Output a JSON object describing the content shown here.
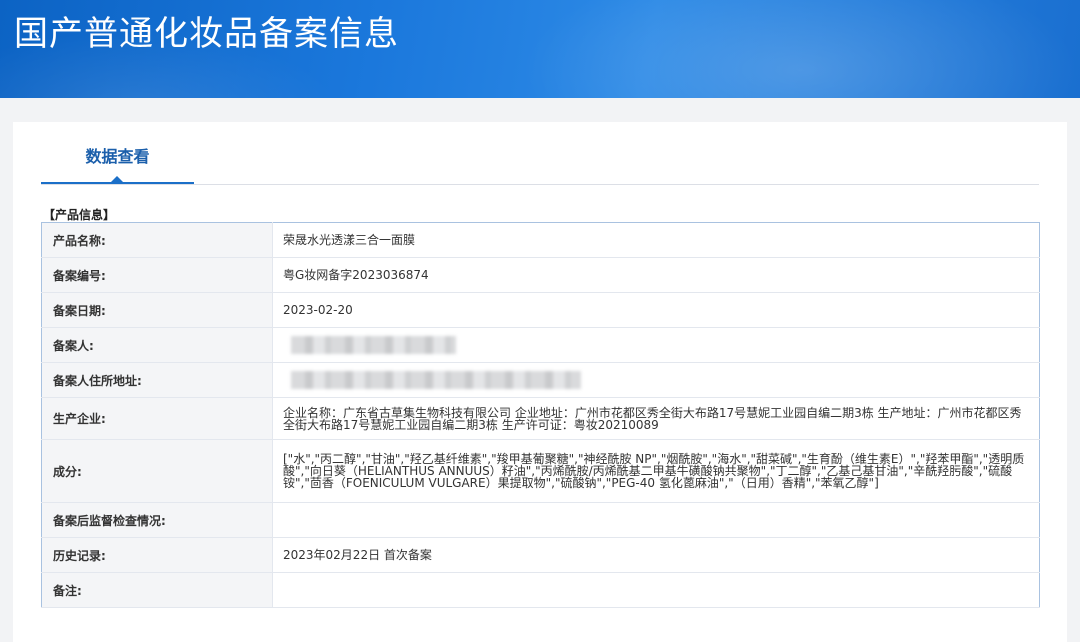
{
  "header": {
    "title": "国产普通化妆品备案信息"
  },
  "tabs": [
    {
      "label": "数据查看"
    }
  ],
  "section": {
    "title": "【产品信息】"
  },
  "rows": [
    {
      "label": "产品名称:",
      "value": "荣晟水光透漾三合一面膜"
    },
    {
      "label": "备案编号:",
      "value": "粤G妆网备字2023036874"
    },
    {
      "label": "备案日期:",
      "value": "2023-02-20"
    },
    {
      "label": "备案人:",
      "value": ""
    },
    {
      "label": "备案人住所地址:",
      "value": ""
    },
    {
      "label": "生产企业:",
      "value": "企业名称：广东省古草集生物科技有限公司 企业地址：广州市花都区秀全街大布路17号慧妮工业园自编二期3栋 生产地址：广州市花都区秀全街大布路17号慧妮工业园自编二期3栋 生产许可证：粤妆20210089"
    },
    {
      "label": "成分:",
      "value": "[\"水\",\"丙二醇\",\"甘油\",\"羟乙基纤维素\",\"羧甲基葡聚糖\",\"神经酰胺 NP\",\"烟酰胺\",\"海水\",\"甜菜碱\",\"生育酚（维生素E）\",\"羟苯甲酯\",\"透明质酸\",\"向日葵（HELIANTHUS ANNUUS）籽油\",\"丙烯酰胺/丙烯酰基二甲基牛磺酸钠共聚物\",\"丁二醇\",\"乙基己基甘油\",\"辛酰羟肟酸\",\"硫酸铵\",\"茴香（FOENICULUM VULGARE）果提取物\",\"硫酸钠\",\"PEG-40 氢化蓖麻油\",\"（日用）香精\",\"苯氧乙醇\"]"
    },
    {
      "label": "备案后监督检查情况:",
      "value": ""
    },
    {
      "label": "历史记录:",
      "value": "2023年02月22日 首次备案"
    },
    {
      "label": "备注:",
      "value": ""
    }
  ]
}
